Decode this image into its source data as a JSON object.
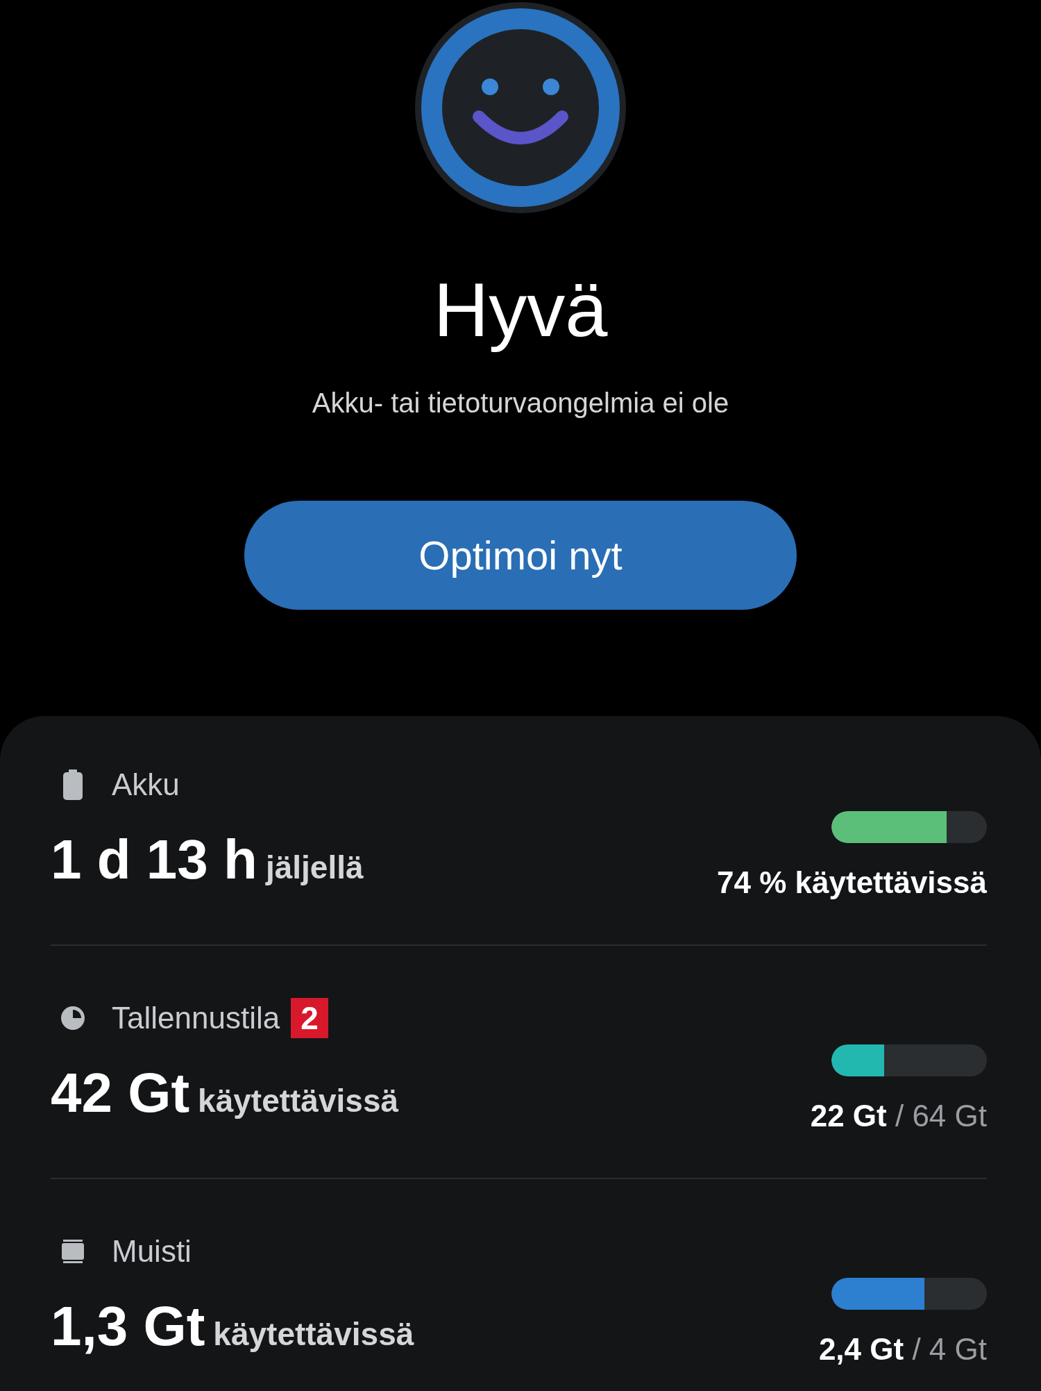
{
  "status": {
    "title": "Hyvä",
    "subtitle": "Akku- tai tietoturvaongelmia ei ole"
  },
  "optimize_button": {
    "label": "Optimoi nyt"
  },
  "items": [
    {
      "kind": "battery",
      "label": "Akku",
      "value": "1 d 13 h",
      "value_suffix": "jäljellä",
      "level": 0.74,
      "color": "#5bbf7a",
      "reading": "**74 % käytettävissä**"
    },
    {
      "kind": "storage",
      "label": "Tallennustila",
      "badge": "2",
      "value": "42 Gt",
      "value_suffix": "käytettävissä",
      "level": 0.34,
      "color": "#22b8b0",
      "reading": "**22 Gt** / 64 Gt"
    },
    {
      "kind": "memory",
      "label": "Muisti",
      "value": "1,3 Gt",
      "value_suffix": "käytettävissä",
      "level": 0.6,
      "color": "#2d7fd0",
      "reading": "**2,4 Gt** / 4 Gt"
    }
  ]
}
